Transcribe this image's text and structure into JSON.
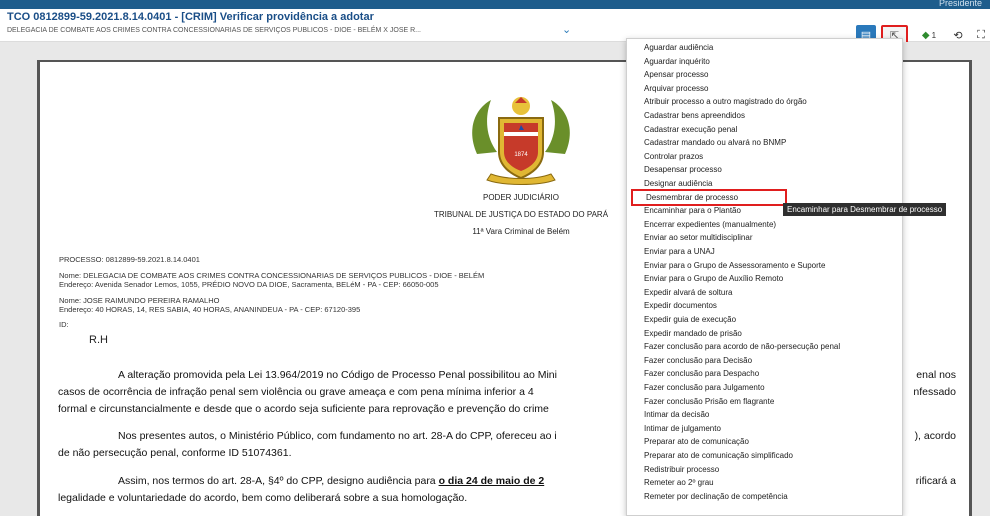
{
  "topbar": {
    "user": "Presidente"
  },
  "header": {
    "title": "TCO 0812899-59.2021.8.14.0401 - [CRIM] Verificar providência a adotar",
    "subtitle": "DELEGACIA DE COMBATE AOS CRIMES CONTRA CONCESSIONARIAS DE SERVIÇOS PUBLICOS - DIOE - BELÉM X JOSE R...",
    "chevron": "⌄"
  },
  "toolbar": {
    "note_icon": "▤",
    "share_icon": "⇱",
    "tag_icon": "◆",
    "tag_count": "1",
    "history_icon": "⟲",
    "expand_icon": "⛶"
  },
  "document": {
    "org1": "PODER JUDICIÁRIO",
    "org2": "TRIBUNAL DE JUSTIÇA DO ESTADO DO PARÁ",
    "org3": "11ª Vara Criminal de Belém",
    "seal_year": "1874",
    "processo": "PROCESSO: 0812899-59.2021.8.14.0401",
    "nome1": "Nome: DELEGACIA DE COMBATE AOS CRIMES CONTRA CONCESSIONARIAS DE SERVIÇOS PUBLICOS - DIOE - BELÉM",
    "endereco1": "Endereço: Avenida Senador Lemos, 1055, PRÉDIO NOVO DA DIOE, Sacramenta, BELéM - PA - CEP: 66050-005",
    "nome2": "Nome: JOSE RAIMUNDO PEREIRA RAMALHO",
    "endereco2": "Endereço: 40 HORAS, 14, RES SABIA, 40 HORAS, ANANINDEUA - PA - CEP: 67120-395",
    "id": "ID:",
    "rh": "R.H",
    "p1": "A alteração promovida pela Lei 13.964/2019 no Código de Processo Penal possibilitou ao Mini",
    "p1b": "enal nos",
    "p1c": "casos de ocorrência de infração penal sem violência ou grave ameaça e com pena mínima inferior a 4",
    "p1d": "nfessado",
    "p1e": "formal e circunstancialmente e desde que o acordo seja  suficiente para reprovação e prevenção do crime",
    "p2": "Nos presentes autos, o Ministério Público, com fundamento no art. 28-A do CPP, ofereceu ao i",
    "p2b": "), acordo",
    "p2c": "de não persecução penal, conforme ID 51074361.",
    "p3": "Assim, nos termos do art. 28-A, §4º do CPP, designo audiência para",
    "p3bold": "o dia 24 de maio de 2",
    "p3b": "rificará a",
    "p3c": "legalidade e voluntariedade do acordo, bem como deliberará sobre a sua homologação."
  },
  "menu": {
    "items": [
      "Aguardar audiência",
      "Aguardar inquérito",
      "Apensar processo",
      "Arquivar processo",
      "Atribuir processo a outro magistrado do órgão",
      "Cadastrar bens apreendidos",
      "Cadastrar execução penal",
      "Cadastrar mandado ou alvará no BNMP",
      "Controlar prazos",
      "Desapensar processo",
      "Designar audiência",
      "Desmembrar de processo",
      "Encaminhar para o Plantão",
      "Encerrar expedientes (manualmente)",
      "Enviar ao setor multidisciplinar",
      "Enviar para a UNAJ",
      "Enviar para o Grupo de Assessoramento e Suporte",
      "Enviar para o Grupo de Auxílio Remoto",
      "Expedir alvará de soltura",
      "Expedir documentos",
      "Expedir guia de execução",
      "Expedir mandado de prisão",
      "Fazer conclusão para acordo de não-persecução penal",
      "Fazer conclusão para Decisão",
      "Fazer conclusão para Despacho",
      "Fazer conclusão para Julgamento",
      "Fazer conclusão Prisão em flagrante",
      "Intimar da decisão",
      "Intimar de julgamento",
      "Preparar ato de comunicação",
      "Preparar ato de comunicação simplificado",
      "Redistribuir processo",
      "Remeter ao 2º grau",
      "Remeter por declinação de competência"
    ],
    "highlighted_index": 11
  },
  "tooltip": "Encaminhar para Desmembrar de processo",
  "colors": {
    "brand": "#1e5d8c",
    "title": "#1a4e87",
    "highlight": "#e01e1e"
  }
}
